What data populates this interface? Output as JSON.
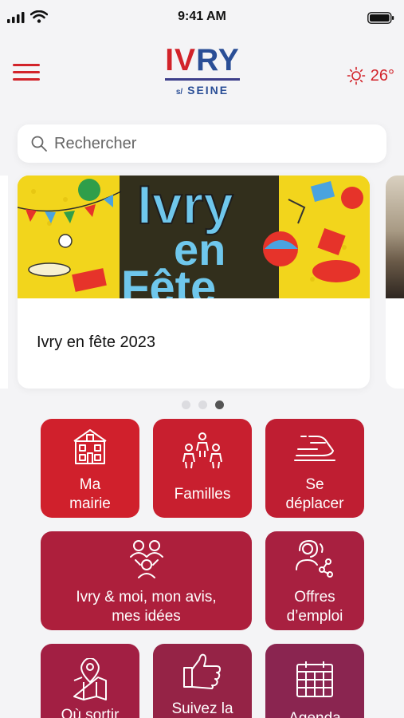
{
  "status_bar": {
    "time": "9:41 AM"
  },
  "header": {
    "logo": {
      "text_red": "IV",
      "text_blue": "RY",
      "sub_super": "s/",
      "sub": "SEINE"
    },
    "weather": {
      "icon": "sun-icon",
      "temperature": "26°"
    },
    "menu_icon": "hamburger-icon"
  },
  "search": {
    "placeholder": "Rechercher",
    "value": "",
    "icon": "search-icon"
  },
  "carousel": {
    "cards": [
      {
        "title": "Ivry en fête 2023",
        "poster_text_1": "Ivry",
        "poster_text_2": "en",
        "poster_text_3": "Fête"
      }
    ],
    "page_count": 3,
    "active_page": 3
  },
  "tiles": [
    {
      "label": "Ma\nmairie",
      "icon": "town-hall-icon",
      "color": "#d0202c"
    },
    {
      "label": "Familles",
      "icon": "family-icon",
      "color": "#c81f2f"
    },
    {
      "label": "Se\ndéplacer",
      "icon": "train-icon",
      "color": "#bf1e32"
    },
    {
      "label": "Ivry & moi, mon avis,\nmes idées",
      "icon": "community-icon",
      "color": "#ad1f3c"
    },
    {
      "label": "Offres\nd’emploi",
      "icon": "job-network-icon",
      "color": "#a82040"
    },
    {
      "label": "Où sortir",
      "icon": "map-pin-icon",
      "color": "#a21f43"
    },
    {
      "label": "Suivez la",
      "icon": "thumbs-up-icon",
      "color": "#952346"
    },
    {
      "label": "Agenda",
      "icon": "calendar-icon",
      "color": "#8a2550"
    }
  ],
  "colors": {
    "accent": "#d2232a",
    "brand_blue": "#2a4e96"
  }
}
